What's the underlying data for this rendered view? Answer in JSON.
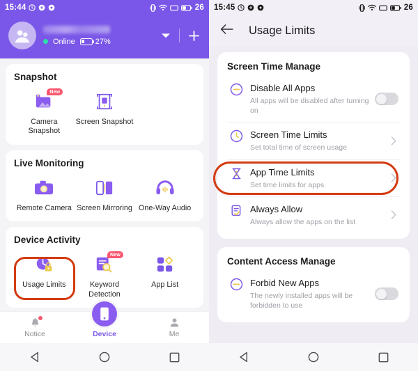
{
  "left_screen": {
    "statusbar": {
      "time": "15:44",
      "battery_text": "26",
      "icons": [
        "alarm-icon",
        "download-icon",
        "record-icon",
        "vibrate-icon",
        "wifi-icon",
        "signal-icon",
        "battery-icon"
      ]
    },
    "account": {
      "name_redacted": "",
      "status_label": "Online",
      "battery_percent": "27%",
      "caret_label": "chevron-down-icon",
      "add_label": "plus-icon"
    },
    "sections": [
      {
        "title": "Snapshot",
        "items": [
          {
            "label": "Camera Snapshot",
            "icon": "camera-snapshot-icon",
            "badge": "New"
          },
          {
            "label": "Screen Snapshot",
            "icon": "screen-snapshot-icon",
            "badge": ""
          }
        ]
      },
      {
        "title": "Live Monitoring",
        "items": [
          {
            "label": "Remote Camera",
            "icon": "remote-camera-icon",
            "badge": ""
          },
          {
            "label": "Screen Mirroring",
            "icon": "screen-mirroring-icon",
            "badge": ""
          },
          {
            "label": "One-Way Audio",
            "icon": "one-way-audio-icon",
            "badge": ""
          }
        ]
      },
      {
        "title": "Device Activity",
        "items": [
          {
            "label": "Usage Limits",
            "icon": "usage-limits-icon",
            "badge": ""
          },
          {
            "label": "Keyword Detection",
            "icon": "keyword-detection-icon",
            "badge": "New"
          },
          {
            "label": "App List",
            "icon": "app-list-icon",
            "badge": ""
          }
        ]
      }
    ],
    "bottom_nav": [
      {
        "label": "Notice",
        "icon": "bell-icon",
        "active": false,
        "has_dot": true
      },
      {
        "label": "Device",
        "icon": "phone-icon",
        "active": true,
        "has_dot": false
      },
      {
        "label": "Me",
        "icon": "person-icon",
        "active": false,
        "has_dot": false
      }
    ],
    "system_nav": [
      "back-triangle-icon",
      "home-circle-icon",
      "recents-square-icon"
    ]
  },
  "right_screen": {
    "statusbar": {
      "time": "15:45",
      "battery_text": "26"
    },
    "header": {
      "back": "back-arrow-icon",
      "title": "Usage Limits"
    },
    "sections": [
      {
        "title": "Screen Time Manage",
        "rows": [
          {
            "icon": "disable-apps-icon",
            "title": "Disable All Apps",
            "subtitle": "All apps will be disabled after turning on",
            "control": "toggle",
            "toggle_on": false
          },
          {
            "icon": "clock-icon",
            "title": "Screen Time Limits",
            "subtitle": "Set total time of screen usage",
            "control": "chevron",
            "toggle_on": false
          },
          {
            "icon": "hourglass-icon",
            "title": "App Time Limits",
            "subtitle": "Set time limits for apps",
            "control": "chevron",
            "toggle_on": false
          },
          {
            "icon": "allow-list-icon",
            "title": "Always Allow",
            "subtitle": "Always allow the apps on the list",
            "control": "chevron",
            "toggle_on": false
          }
        ]
      },
      {
        "title": "Content Access Manage",
        "rows": [
          {
            "icon": "forbid-icon",
            "title": "Forbid New Apps",
            "subtitle": "The newly installed apps will be forbidden to use",
            "control": "toggle",
            "toggle_on": false
          }
        ]
      }
    ],
    "system_nav": [
      "back-triangle-icon",
      "home-circle-icon",
      "recents-square-icon"
    ]
  },
  "annotations": {
    "highlight_color": "#d33b10",
    "highlight_left_target": "Usage Limits",
    "highlight_right_target": "Screen Time Limits"
  },
  "theme": {
    "brand_purple": "#7a57e8",
    "accent_yellow": "#ecc94b",
    "badge_red": "#f9576f",
    "page_bg": "#f4f4f6"
  }
}
